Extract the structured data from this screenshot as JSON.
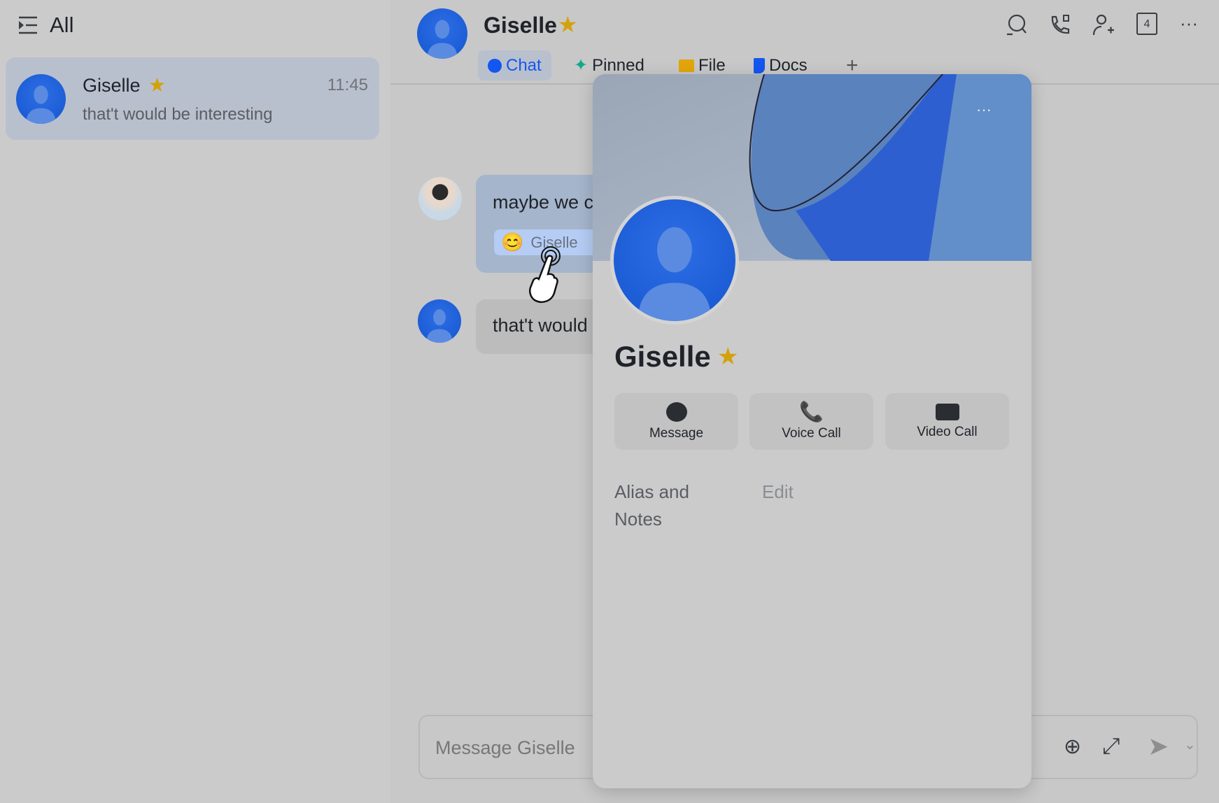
{
  "sidebar": {
    "title": "All",
    "conversations": [
      {
        "name": "Giselle",
        "time": "11:45",
        "preview": "that't would be interesting",
        "starred": true
      }
    ]
  },
  "header": {
    "name": "Giselle",
    "starred": true,
    "tabs": [
      {
        "label": "Chat",
        "icon": "chat-bubble-icon",
        "active": true
      },
      {
        "label": "Pinned",
        "icon": "pin-icon"
      },
      {
        "label": "File",
        "icon": "folder-icon"
      },
      {
        "label": "Docs",
        "icon": "docs-icon"
      }
    ],
    "add_tab": "+",
    "actions": [
      "search-icon",
      "call-icon",
      "add-member-icon",
      "calendar-icon",
      "more-icon"
    ],
    "calendar_day": "4"
  },
  "messages": [
    {
      "text": "maybe we c",
      "reaction": {
        "emoji": "😊",
        "by": "Giselle"
      }
    },
    {
      "text": "that't would"
    }
  ],
  "input": {
    "placeholder": "Message Giselle"
  },
  "profile": {
    "name": "Giselle",
    "starred": true,
    "more": "···",
    "buttons": [
      {
        "label": "Message",
        "icon": "message-icon"
      },
      {
        "label": "Voice Call",
        "icon": "phone-icon"
      },
      {
        "label": "Video Call",
        "icon": "video-icon"
      }
    ],
    "alias_label": "Alias and Notes",
    "alias_label_line1": "Alias and",
    "alias_label_line2": "Notes",
    "edit": "Edit"
  },
  "colors": {
    "accent": "#1456f0",
    "star": "#d4a10a",
    "pin": "#14a88a",
    "folder": "#e2a50b"
  }
}
